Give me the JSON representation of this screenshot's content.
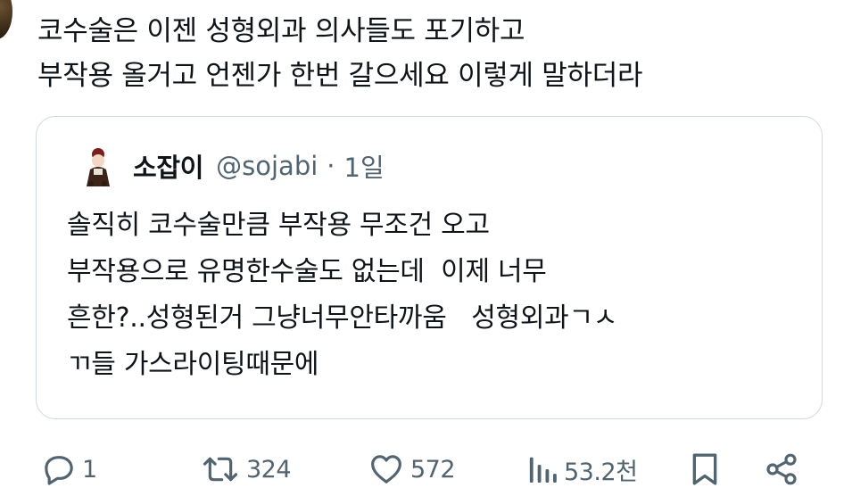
{
  "tweet": {
    "text_lines": [
      "코수술은 이젠 성형외과 의사들도 포기하고",
      "부작용 올거고 언젠가 한번 갈으세요 이렇게 말하더라"
    ]
  },
  "quote": {
    "author_name": "소잡이",
    "handle": "@sojabi",
    "separator": "·",
    "time": "1일",
    "body_lines": [
      "솔직히 코수술만큼 부작용 무조건 오고",
      "부작용으로 유명한수술도 없는데  이제 너무",
      "흔한?..성형된거 그냥너무안타까움   성형외과ㄱㅅ",
      "ㄲ들 가스라이팅때문에"
    ]
  },
  "actions": {
    "reply_count": "1",
    "repost_count": "324",
    "like_count": "572",
    "views_count": "53.2천"
  },
  "icons": {
    "reply": "reply-icon",
    "repost": "repost-icon",
    "like": "heart-icon",
    "views": "views-icon",
    "bookmark": "bookmark-icon",
    "share": "share-icon"
  },
  "colors": {
    "text": "#0f1419",
    "secondary": "#536471",
    "border": "#cfd9de"
  }
}
